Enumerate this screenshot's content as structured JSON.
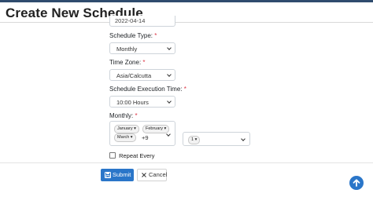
{
  "header": {
    "title": "Create New Schedule"
  },
  "form": {
    "start_date": {
      "value": "2022-04-14"
    },
    "schedule_type": {
      "label": "Schedule Type:",
      "required": "*",
      "value": "Monthly"
    },
    "time_zone": {
      "label": "Time Zone:",
      "required": "*",
      "value": "Asia/Calcutta"
    },
    "execution_time": {
      "label": "Schedule Execution Time:",
      "required": "*",
      "value": "10:00 Hours"
    },
    "monthly": {
      "label": "Monthly:",
      "required": "*",
      "months_selected": [
        "January",
        "February",
        "March"
      ],
      "more": "+9",
      "day_selected": "1"
    },
    "repeat_every": {
      "label": "Repeat Every",
      "checked": false
    }
  },
  "buttons": {
    "submit": "Submit",
    "cancel": "Cancel"
  },
  "colors": {
    "primary": "#2a76c9",
    "required": "#dc3545",
    "header_bar": "#2f4c6e"
  },
  "icons": [
    "save-icon",
    "close-icon",
    "chevron-down-icon",
    "arrow-up-icon"
  ]
}
